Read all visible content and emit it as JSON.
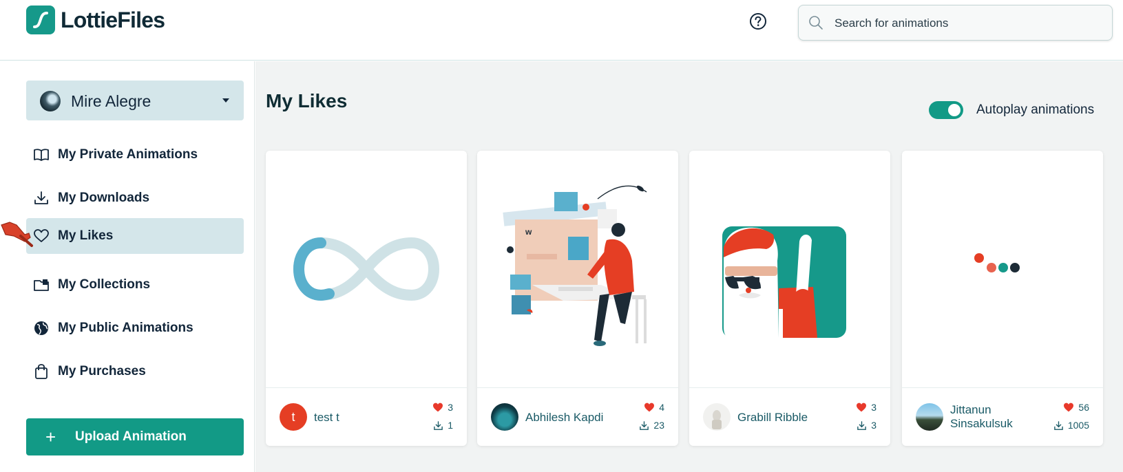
{
  "header": {
    "logo_text": "LottieFiles",
    "search_placeholder": "Search for animations"
  },
  "sidebar": {
    "user_name": "Mire Alegre",
    "items": [
      {
        "label": "My Private Animations",
        "icon": "book-icon"
      },
      {
        "label": "My Downloads",
        "icon": "download-icon"
      },
      {
        "label": "My Likes",
        "icon": "heart-icon",
        "active": true
      },
      {
        "label": "My Collections",
        "icon": "collection-icon"
      },
      {
        "label": "My Public Animations",
        "icon": "globe-icon"
      },
      {
        "label": "My Purchases",
        "icon": "shopping-bag-icon"
      }
    ],
    "upload_label": "Upload Animation"
  },
  "main": {
    "title": "My Likes",
    "autoplay_label": "Autoplay animations",
    "autoplay_on": true,
    "cards": [
      {
        "author": "test t",
        "avatar_letter": "t",
        "likes": "3",
        "downloads": "1"
      },
      {
        "author": "Abhilesh Kapdi",
        "likes": "4",
        "downloads": "23"
      },
      {
        "author": "Grabill Ribble",
        "likes": "3",
        "downloads": "3"
      },
      {
        "author": "Jittanun Sinsakulsuk",
        "likes": "56",
        "downloads": "1005"
      }
    ]
  },
  "colors": {
    "brand": "#129a86",
    "active_nav": "#d4e6ea",
    "heart": "#e8392b",
    "text": "#12263a"
  }
}
